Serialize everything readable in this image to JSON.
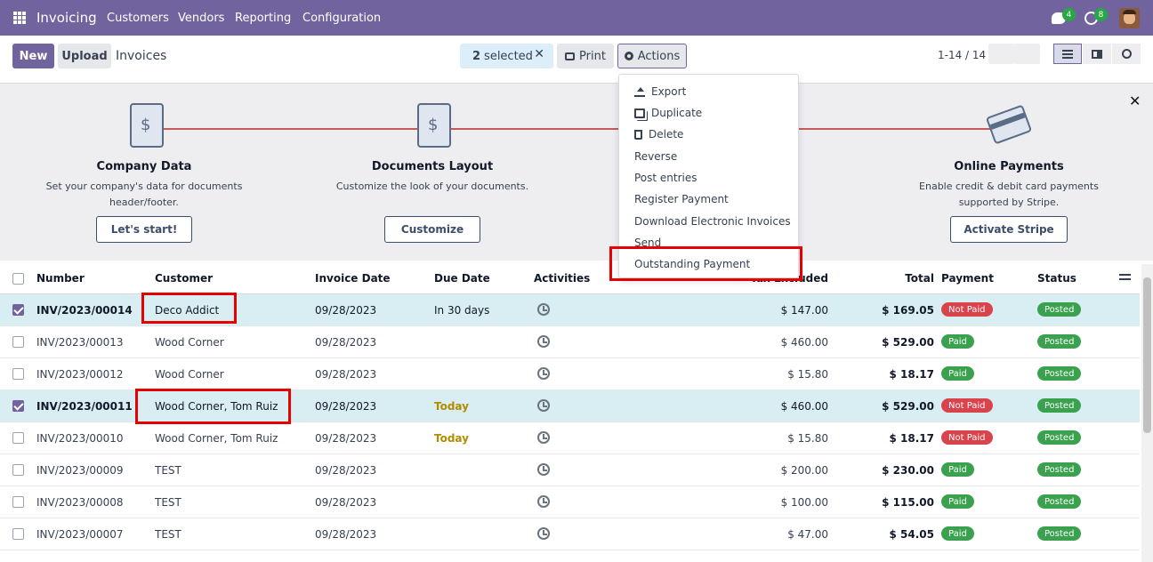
{
  "navbar": {
    "brand": "Invoicing",
    "menu": [
      "Customers",
      "Vendors",
      "Reporting",
      "Configuration"
    ],
    "chat_count": "4",
    "activity_count": "8"
  },
  "control": {
    "new_label": "New",
    "upload_label": "Upload",
    "title": "Invoices",
    "selected_count": "2",
    "selected_text": "selected",
    "print_label": "Print",
    "actions_label": "Actions",
    "pager": "1-14 / 14"
  },
  "onboarding": {
    "steps": [
      {
        "title": "Company Data",
        "desc1": "Set your company's data for documents",
        "desc2": "header/footer.",
        "button": "Let's start!"
      },
      {
        "title": "Documents Layout",
        "desc1": "Customize the look of your documents.",
        "desc2": "",
        "button": "Customize"
      },
      {
        "title": "Online Payments",
        "desc1": "Enable credit & debit card payments",
        "desc2": "supported by Stripe.",
        "button": "Activate Stripe"
      }
    ]
  },
  "actions_menu": {
    "items": [
      "Export",
      "Duplicate",
      "Delete",
      "Reverse",
      "Post entries",
      "Register Payment",
      "Download Electronic Invoices",
      "Send",
      "Outstanding Payment"
    ]
  },
  "table": {
    "columns": [
      "Number",
      "Customer",
      "Invoice Date",
      "Due Date",
      "Activities",
      "Tax Excluded",
      "Total",
      "Payment",
      "Status"
    ],
    "rows": [
      {
        "number": "INV/2023/00014",
        "customer": "Deco Addict",
        "date": "09/28/2023",
        "due": "In 30 days",
        "untaxed": "$ 147.00",
        "total": "$ 169.05",
        "payment": "Not Paid",
        "status": "Posted",
        "selected": true
      },
      {
        "number": "INV/2023/00013",
        "customer": "Wood Corner",
        "date": "09/28/2023",
        "due": "",
        "untaxed": "$ 460.00",
        "total": "$ 529.00",
        "payment": "Paid",
        "status": "Posted",
        "selected": false
      },
      {
        "number": "INV/2023/00012",
        "customer": "Wood Corner",
        "date": "09/28/2023",
        "due": "",
        "untaxed": "$ 15.80",
        "total": "$ 18.17",
        "payment": "Paid",
        "status": "Posted",
        "selected": false
      },
      {
        "number": "INV/2023/00011",
        "customer": "Wood Corner, Tom Ruiz",
        "date": "09/28/2023",
        "due": "Today",
        "untaxed": "$ 460.00",
        "total": "$ 529.00",
        "payment": "Not Paid",
        "status": "Posted",
        "selected": true
      },
      {
        "number": "INV/2023/00010",
        "customer": "Wood Corner, Tom Ruiz",
        "date": "09/28/2023",
        "due": "Today",
        "untaxed": "$ 15.80",
        "total": "$ 18.17",
        "payment": "Not Paid",
        "status": "Posted",
        "selected": false
      },
      {
        "number": "INV/2023/00009",
        "customer": "TEST",
        "date": "09/28/2023",
        "due": "",
        "untaxed": "$ 200.00",
        "total": "$ 230.00",
        "payment": "Paid",
        "status": "Posted",
        "selected": false
      },
      {
        "number": "INV/2023/00008",
        "customer": "TEST",
        "date": "09/28/2023",
        "due": "",
        "untaxed": "$ 100.00",
        "total": "$ 115.00",
        "payment": "Paid",
        "status": "Posted",
        "selected": false
      },
      {
        "number": "INV/2023/00007",
        "customer": "TEST",
        "date": "09/28/2023",
        "due": "",
        "untaxed": "$ 47.00",
        "total": "$ 54.05",
        "payment": "Paid",
        "status": "Posted",
        "selected": false
      }
    ]
  },
  "colors": {
    "brand": "#71639e",
    "not_paid": "#d9434b",
    "paid": "#3aa24f",
    "annotation": "#e60000"
  },
  "icons": [
    "apps-grid-icon",
    "chat-icon",
    "clock-icon",
    "print-icon",
    "gear-icon",
    "upload-icon",
    "copy-icon",
    "trash-icon",
    "list-view-icon",
    "kanban-view-icon",
    "activity-view-icon",
    "sliders-icon"
  ]
}
